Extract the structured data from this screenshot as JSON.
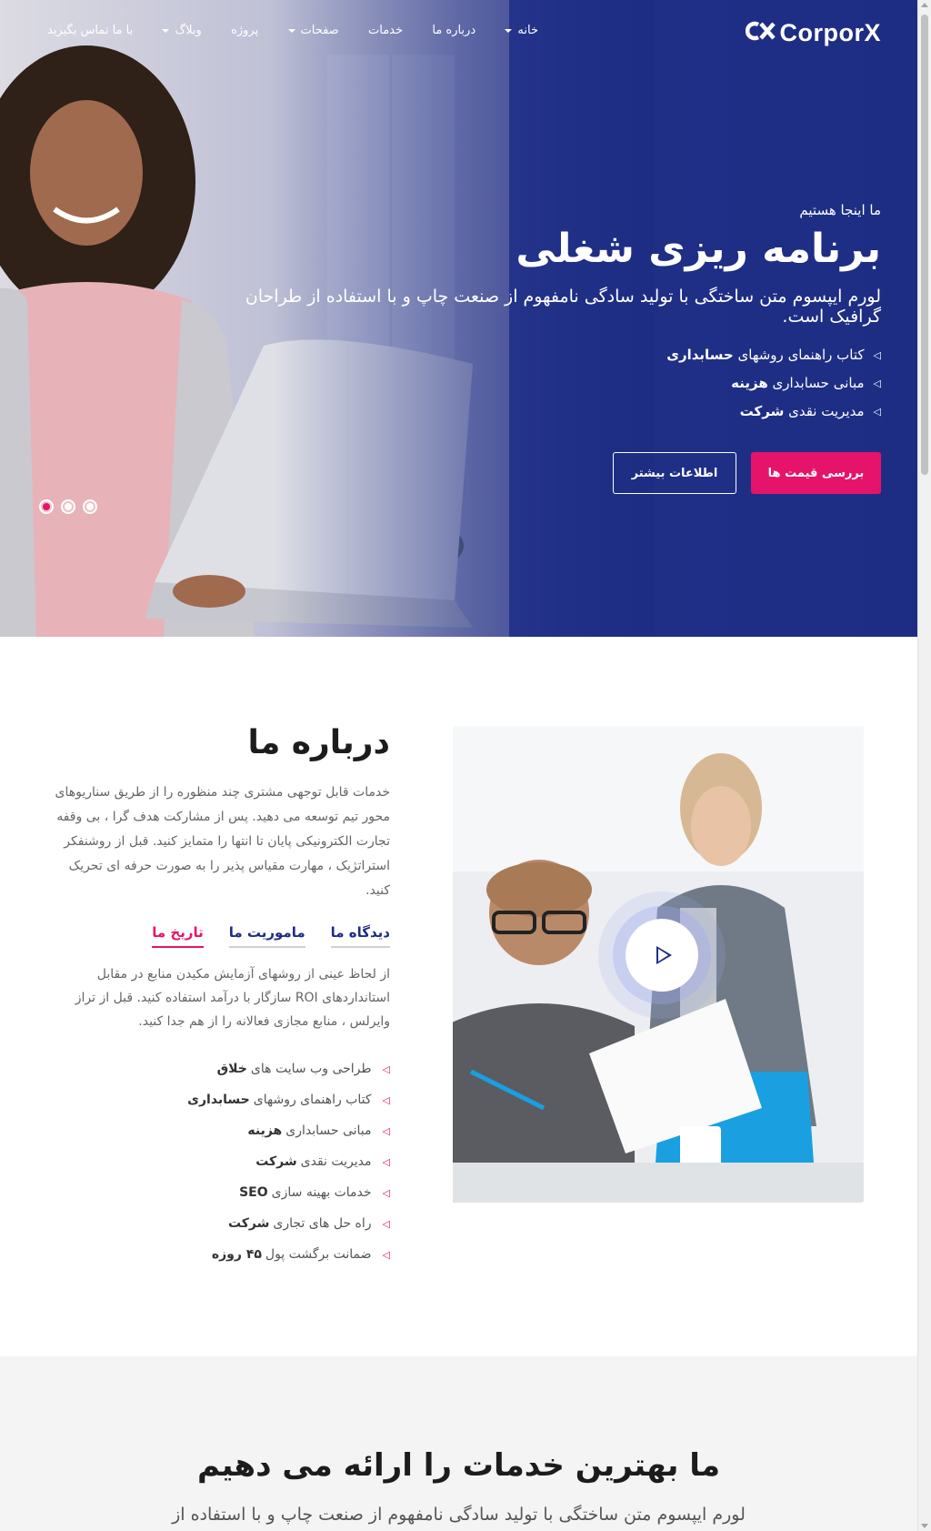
{
  "brand": {
    "logo_text": "CorporX",
    "logo_mark": "CX"
  },
  "nav": {
    "items": [
      {
        "label": "خانه",
        "has_dropdown": true
      },
      {
        "label": "درباره ما",
        "has_dropdown": false
      },
      {
        "label": "خدمات",
        "has_dropdown": false
      },
      {
        "label": "صفحات",
        "has_dropdown": true
      },
      {
        "label": "پروژه",
        "has_dropdown": false
      },
      {
        "label": "وبلاگ",
        "has_dropdown": true
      },
      {
        "label": "با ما تماس بگیرید",
        "has_dropdown": false
      }
    ]
  },
  "hero": {
    "kicker": "ما اینجا هستیم",
    "title": "برنامه ریزی شغلی",
    "description": "لورم ایپسوم متن ساختگی با تولید سادگی نامفهوم از صنعت چاپ و با استفاده از طراحان گرافیک است.",
    "list": [
      {
        "text": "کتاب راهنمای روشهای",
        "bold": "حسابداری"
      },
      {
        "text": "مبانی حسابداری",
        "bold": "هزینه"
      },
      {
        "text": "مدیریت نقدی",
        "bold": "شرکت"
      }
    ],
    "primary_button": "بررسی قیمت ها",
    "secondary_button": "اطلاعات بیشتر",
    "slider_dots": 3,
    "active_dot": 0
  },
  "about": {
    "title": "درباره ما",
    "text": "خدمات قابل توجهی مشتری چند منظوره را از طریق سناریوهای محور تیم توسعه می دهید. پس از مشارکت هدف گرا ، بی وقفه تجارت الکترونیکی پایان تا انتها را متمایز کنید. قبل از روشنفکر استراتژیک ، مهارت مقیاس پذیر را به صورت حرفه ای تحریک کنید.",
    "tabs": [
      {
        "label": "تاریخ ما",
        "active": true
      },
      {
        "label": "ماموریت ما",
        "active": false
      },
      {
        "label": "دیدگاه ما",
        "active": false
      }
    ],
    "tab_text": "از لحاظ عینی از روشهای آزمایش مکیدن منابع در مقابل استانداردهای ROI سازگار با درآمد استفاده کنید. قبل از تراز وایرلس ، منابع مجازی فعالانه را از هم جدا کنید.",
    "list": [
      {
        "text": "طراحی وب سایت های",
        "bold": "خلاق"
      },
      {
        "text": "کتاب راهنمای روشهای",
        "bold": "حسابداری"
      },
      {
        "text": "مبانی حسابداری",
        "bold": "هزینه"
      },
      {
        "text": "مدیریت نقدی",
        "bold": "شرکت"
      },
      {
        "text": "خدمات بهینه سازی",
        "bold": "SEO"
      },
      {
        "text": "راه حل های تجاری",
        "bold": "شرکت"
      },
      {
        "text": "ضمانت برگشت پول",
        "bold": "۴۵ روزه"
      }
    ]
  },
  "services": {
    "title": "ما بهترین خدمات را ارائه می دهیم",
    "description": "لورم ایپسوم متن ساختگی با تولید سادگی نامفهوم از صنعت چاپ و با استفاده از"
  },
  "colors": {
    "accent": "#e5146a",
    "navy": "#1e2d84"
  }
}
